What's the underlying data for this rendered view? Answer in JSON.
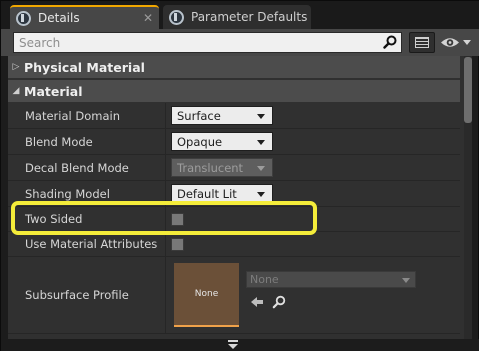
{
  "tabs": [
    {
      "label": "Details",
      "active": true,
      "icon": "details-icon"
    },
    {
      "label": "Parameter Defaults",
      "active": false,
      "icon": "details-icon"
    }
  ],
  "tab_close_glyph": "✕",
  "search": {
    "placeholder": "Search",
    "value": ""
  },
  "categories": {
    "physical_material": "Physical Material",
    "material": "Material"
  },
  "properties": [
    {
      "name": "Material Domain",
      "value": "Surface",
      "type": "combo",
      "enabled": true
    },
    {
      "name": "Blend Mode",
      "value": "Opaque",
      "type": "combo",
      "enabled": true
    },
    {
      "name": "Decal Blend Mode",
      "value": "Translucent",
      "type": "combo",
      "enabled": false
    },
    {
      "name": "Shading Model",
      "value": "Default Lit",
      "type": "combo",
      "enabled": true
    },
    {
      "name": "Two Sided",
      "value": false,
      "type": "checkbox"
    },
    {
      "name": "Use Material Attributes",
      "value": false,
      "type": "checkbox"
    },
    {
      "name": "Subsurface Profile",
      "type": "asset",
      "thumbnail_label": "None",
      "selected": "None"
    }
  ],
  "colors": {
    "accent_tab": "#f1a700",
    "highlight": "#f4ec3a",
    "panel_bg": "#303030",
    "category_bg": "#4c4c4c",
    "thumbnail_border": "#f0a24a"
  }
}
